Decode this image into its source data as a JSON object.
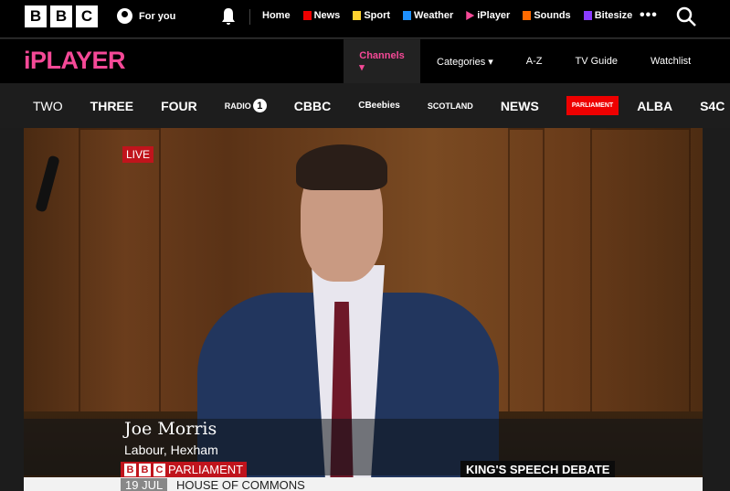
{
  "top_nav": {
    "logo_letters": [
      "B",
      "B",
      "C"
    ],
    "for_you": "For you",
    "items": [
      {
        "label": "Home",
        "color": ""
      },
      {
        "label": "News",
        "color": "#e00"
      },
      {
        "label": "Sport",
        "color": "#ffd230"
      },
      {
        "label": "Weather",
        "color": "#1e90ff"
      },
      {
        "label": "iPlayer",
        "color": "#f54997"
      },
      {
        "label": "Sounds",
        "color": "#ff6a00"
      },
      {
        "label": "Bitesize",
        "color": "#8a3cff"
      }
    ],
    "more": "•••"
  },
  "iplayer": {
    "logo": "iPLAYER",
    "nav": [
      "Channels ▾",
      "Categories ▾",
      "A-Z",
      "TV Guide",
      "Watchlist"
    ]
  },
  "channels": [
    "TWO",
    "THREE",
    "FOUR",
    "RADIO",
    "1",
    "CBBC",
    "CBeebies",
    "SCOTLAND",
    "NEWS",
    "PARLIAMENT",
    "ALBA",
    "S4C"
  ],
  "video": {
    "live": "LIVE",
    "name": "Joe Morris",
    "party": "Labour, Hexham",
    "brand_letters": [
      "B",
      "B",
      "C"
    ],
    "brand": "PARLIAMENT",
    "debate": "KING'S SPEECH DEBATE",
    "date": "19 JUL",
    "house": "HOUSE OF COMMONS"
  },
  "colors": {
    "accent": "#f54997",
    "parliament": "#e00"
  }
}
